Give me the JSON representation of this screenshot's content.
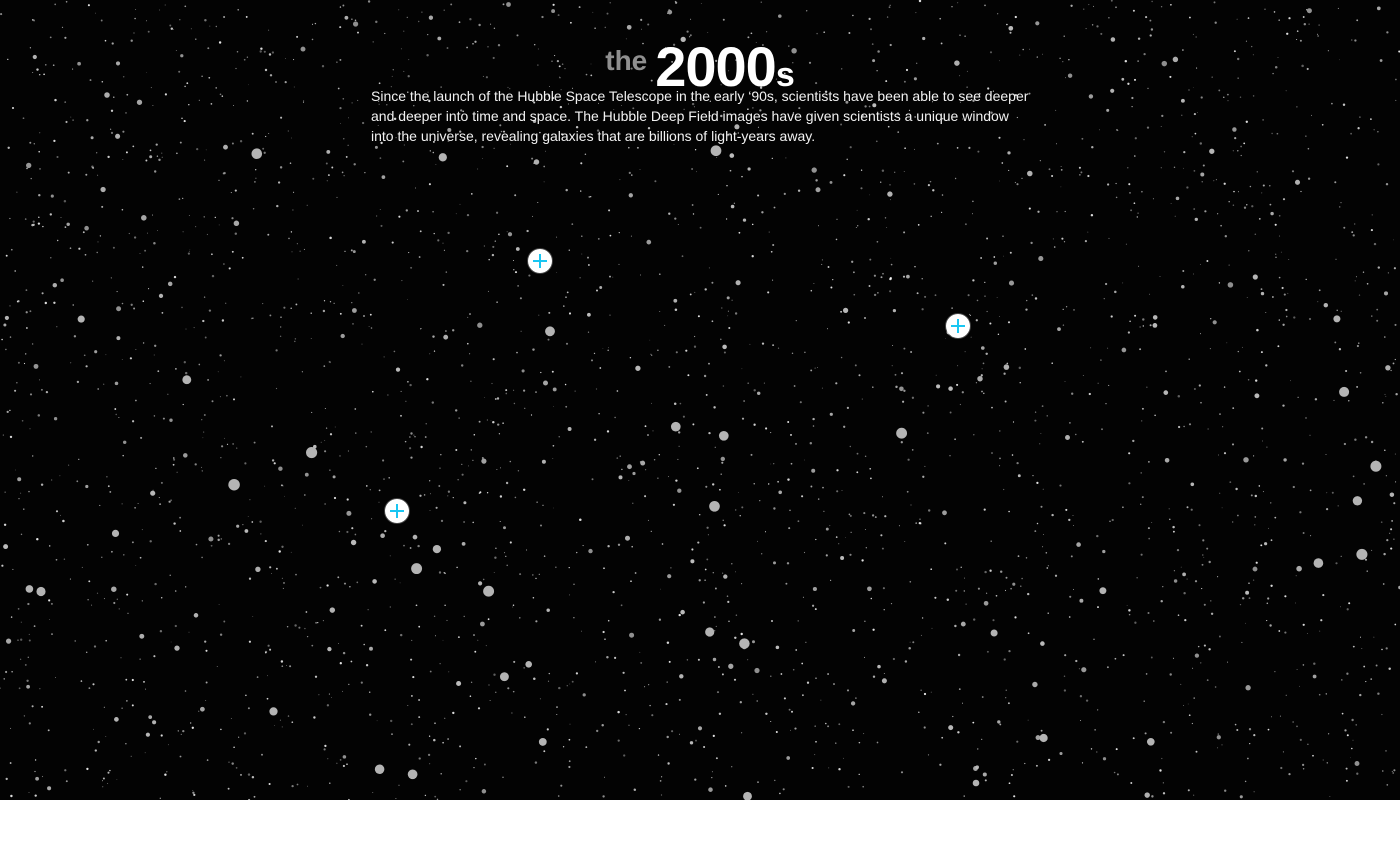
{
  "heading": {
    "prefix": "the",
    "decade": "2000",
    "suffix": "s"
  },
  "intro": {
    "text": "Since the launch of the Hubble Space Telescope in the early ‘90s, scientists have been able to see deeper and deeper into time and space. The Hubble Deep Field images have given scientists a unique window into the universe, revealing galaxies that are billions of light-years away."
  },
  "hotspots": [
    {
      "icon": "plus-icon"
    },
    {
      "icon": "plus-icon"
    },
    {
      "icon": "plus-icon"
    }
  ],
  "colors": {
    "background": "#030303",
    "star": "#bdbdbd",
    "hotspot": "#ffffff",
    "accent": "#19c6f2",
    "heading_prefix": "#8f8f8f"
  }
}
